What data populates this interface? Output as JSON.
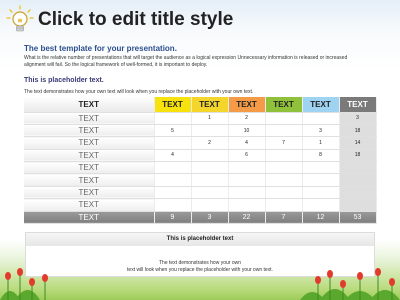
{
  "slide": {
    "title": "Click to edit title style",
    "subtitle": "The best template for your presentation.",
    "description": "What is the relative number of presentations that will target the audience as a logical expression Unnecessary information is released or increased alignment will fail. So the logical framework of well-formed, it is important to deploy.",
    "placeholder_title": "This is placeholder text.",
    "placeholder_desc": "The text demonstrates how your own text will look when you replace the placeholder with your own text."
  },
  "table": {
    "header": [
      "TEXT",
      "TEXT",
      "TEXT",
      "TEXT",
      "TEXT",
      "TEXT",
      "TEXT"
    ],
    "header_colors": [
      "#ffffff",
      "#f8e20e",
      "#f3d52c",
      "#f59a47",
      "#8fc23a",
      "#9fd3f2",
      "#7a7a7a"
    ],
    "rows": [
      [
        "TEXT",
        "",
        "1",
        "2",
        "",
        "",
        "3"
      ],
      [
        "TEXT",
        "5",
        "",
        "10",
        "",
        "3",
        "18"
      ],
      [
        "TEXT",
        "",
        "2",
        "4",
        "7",
        "1",
        "14"
      ],
      [
        "TEXT",
        "4",
        "",
        "6",
        "",
        "8",
        "18"
      ],
      [
        "TEXT",
        "",
        "",
        "",
        "",
        "",
        ""
      ],
      [
        "TEXT",
        "",
        "",
        "",
        "",
        "",
        ""
      ],
      [
        "TEXT",
        "",
        "",
        "",
        "",
        "",
        ""
      ],
      [
        "TEXT",
        "",
        "",
        "",
        "",
        "",
        ""
      ]
    ],
    "footer": [
      "TEXT",
      "9",
      "3",
      "22",
      "7",
      "12",
      "53"
    ]
  },
  "box": {
    "title": "This is placeholder text",
    "line1": "The text demonstrates how your own",
    "line2": "text will look when you replace the placeholder with your own text."
  }
}
